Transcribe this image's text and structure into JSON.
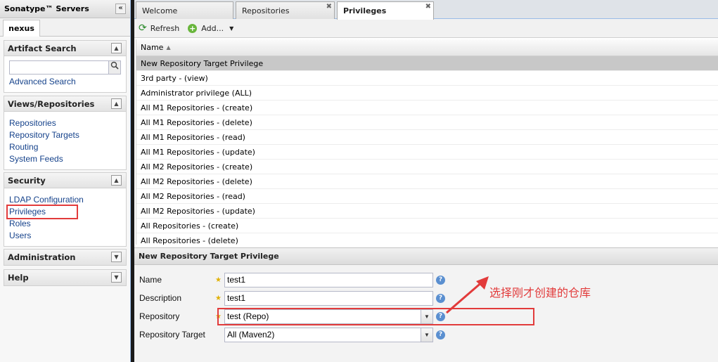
{
  "left": {
    "title": "Sonatype™ Servers",
    "collapse_glyph": "«",
    "server_tab": "nexus",
    "artifact_search": {
      "title": "Artifact Search",
      "search_value": "",
      "advanced_link": "Advanced Search"
    },
    "views": {
      "title": "Views/Repositories",
      "items": [
        "Repositories",
        "Repository Targets",
        "Routing",
        "System Feeds"
      ]
    },
    "security": {
      "title": "Security",
      "items": [
        "LDAP Configuration",
        "Privileges",
        "Roles",
        "Users"
      ]
    },
    "administration": {
      "title": "Administration"
    },
    "help": {
      "title": "Help"
    }
  },
  "tabs": [
    {
      "label": "Welcome"
    },
    {
      "label": "Repositories"
    },
    {
      "label": "Privileges"
    }
  ],
  "toolbar": {
    "refresh": "Refresh",
    "add": "Add..."
  },
  "grid": {
    "column": "Name",
    "rows": [
      "New Repository Target Privilege",
      "3rd party - (view)",
      "Administrator privilege (ALL)",
      "All M1 Repositories - (create)",
      "All M1 Repositories - (delete)",
      "All M1 Repositories - (read)",
      "All M1 Repositories - (update)",
      "All M2 Repositories - (create)",
      "All M2 Repositories - (delete)",
      "All M2 Repositories - (read)",
      "All M2 Repositories - (update)",
      "All Repositories - (create)",
      "All Repositories - (delete)"
    ]
  },
  "form": {
    "title": "New Repository Target Privilege",
    "name_label": "Name",
    "name_value": "test1",
    "description_label": "Description",
    "description_value": "test1",
    "repository_label": "Repository",
    "repository_value": "test (Repo)",
    "target_label": "Repository Target",
    "target_value": "All (Maven2)"
  },
  "annotation": "选择刚才创建的仓库",
  "colors": {
    "link": "#15428b",
    "highlight": "#e23b3b",
    "selected_row": "#c8c8c8"
  }
}
